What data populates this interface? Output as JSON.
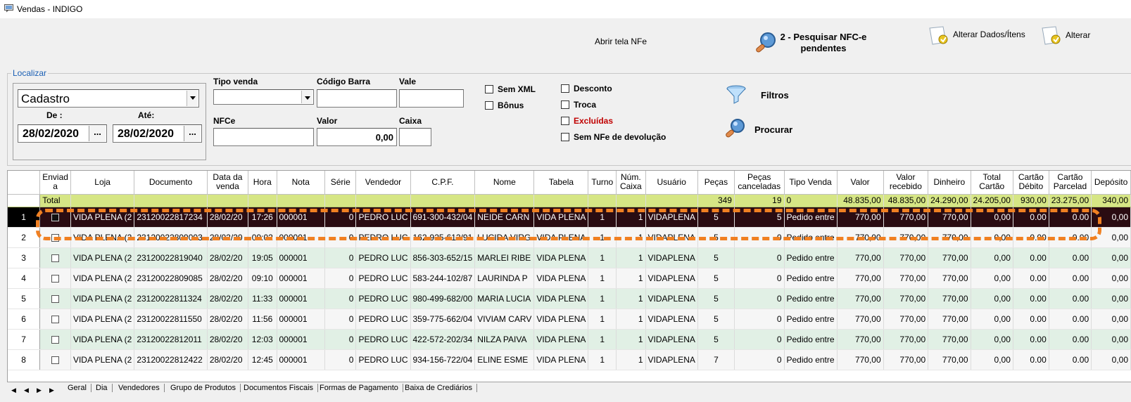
{
  "window": {
    "title": "Vendas - INDIGO"
  },
  "toolbar": {
    "open_nfe": "Abrir tela NFe",
    "pesquisar_line1": "2 - Pesquisar NFC-e",
    "pesquisar_line2": "pendentes",
    "alterar_dados": "Alterar Dados/Ítens",
    "alterar": "Alterar"
  },
  "search": {
    "group_title": "Localizar",
    "cadastro_value": "Cadastro",
    "de_label": "De :",
    "ate_label": "Até:",
    "de_value": "28/02/2020",
    "ate_value": "28/02/2020",
    "date_button": "...",
    "tipo_venda_label": "Tipo venda",
    "tipo_venda_value": "",
    "codigo_barra_label": "Código Barra",
    "codigo_barra_value": "",
    "vale_label": "Vale",
    "vale_value": "",
    "nfce_label": "NFCe",
    "nfce_value": "",
    "valor_label": "Valor",
    "valor_value": "0,00",
    "caixa_label": "Caixa",
    "caixa_value": "",
    "checkboxes": {
      "sem_xml": "Sem XML",
      "bonus": "Bônus",
      "desconto": "Desconto",
      "troca": "Troca",
      "excluidas": "Excluídas",
      "sem_nfe_devolucao": "Sem NFe de devolução"
    },
    "filtros": "Filtros",
    "procurar": "Procurar"
  },
  "colors": {
    "excluidas": "#c00000",
    "total_row": "#d6e685",
    "selected_row": "#2a0c12",
    "highlight": "#f08022",
    "even_row": "#e1f0e5"
  },
  "grid": {
    "headers": [
      "Enviad a",
      "Loja",
      "Documento",
      "Data da venda",
      "Hora",
      "Nota",
      "Série",
      "Vendedor",
      "C.P.F.",
      "Nome",
      "Tabela",
      "Turno",
      "Núm. Caixa",
      "Usuário",
      "Peças",
      "Peças canceladas",
      "Tipo Venda",
      "Valor",
      "Valor recebido",
      "Dinheiro",
      "Total Cartão",
      "Cartão Débito",
      "Cartão Parcelad",
      "Depósito"
    ],
    "total": {
      "label": "Total",
      "pecas": "349",
      "pecas_canceladas": "19",
      "tipo_venda": "0",
      "valor": "48.835,00",
      "valor_recebido": "48.835,00",
      "dinheiro": "24.290,00",
      "total_cartao": "24.205,00",
      "cartao_debito": "930,00",
      "cartao_parcelado": "23.275,00",
      "deposito": "340,00"
    },
    "rows": [
      {
        "n": "1",
        "loja": "VIDA PLENA (2",
        "doc": "23120022817234",
        "data": "28/02/20",
        "hora": "17:26",
        "nota": "000001",
        "serie": "0",
        "vendedor": "PEDRO LUC",
        "cpf": "691-300-432/04",
        "nome": "NEIDE CARN",
        "tabela": "VIDA PLENA",
        "turno": "1",
        "caixa": "1",
        "usuario": "VIDAPLENA",
        "pecas": "5",
        "canc": "5",
        "tipo": "Pedido entre",
        "valor": "770,00",
        "recebido": "770,00",
        "dinheiro": "770,00",
        "cartao": "0,00",
        "debito": "0.00",
        "parcelado": "0.00",
        "deposito": "0,00"
      },
      {
        "n": "2",
        "loja": "VIDA PLENA (2",
        "doc": "23120022809003",
        "data": "28/02/20",
        "hora": "09:02",
        "nota": "000001",
        "serie": "0",
        "vendedor": "PEDRO LUC",
        "cpf": "162-925-612/91",
        "nome": "LUCIDA VIRG",
        "tabela": "VIDA PLENA",
        "turno": "1",
        "caixa": "1",
        "usuario": "VIDAPLENA",
        "pecas": "5",
        "canc": "0",
        "tipo": "Pedido entre",
        "valor": "770,00",
        "recebido": "770,00",
        "dinheiro": "770,00",
        "cartao": "0,00",
        "debito": "0.00",
        "parcelado": "0.00",
        "deposito": "0,00"
      },
      {
        "n": "3",
        "loja": "VIDA PLENA (2",
        "doc": "23120022819040",
        "data": "28/02/20",
        "hora": "19:05",
        "nota": "000001",
        "serie": "0",
        "vendedor": "PEDRO LUC",
        "cpf": "856-303-652/15",
        "nome": "MARLEI RIBE",
        "tabela": "VIDA PLENA",
        "turno": "1",
        "caixa": "1",
        "usuario": "VIDAPLENA",
        "pecas": "5",
        "canc": "0",
        "tipo": "Pedido entre",
        "valor": "770,00",
        "recebido": "770,00",
        "dinheiro": "770,00",
        "cartao": "0,00",
        "debito": "0.00",
        "parcelado": "0.00",
        "deposito": "0,00"
      },
      {
        "n": "4",
        "loja": "VIDA PLENA (2",
        "doc": "23120022809085",
        "data": "28/02/20",
        "hora": "09:10",
        "nota": "000001",
        "serie": "0",
        "vendedor": "PEDRO LUC",
        "cpf": "583-244-102/87",
        "nome": "LAURINDA P",
        "tabela": "VIDA PLENA",
        "turno": "1",
        "caixa": "1",
        "usuario": "VIDAPLENA",
        "pecas": "5",
        "canc": "0",
        "tipo": "Pedido entre",
        "valor": "770,00",
        "recebido": "770,00",
        "dinheiro": "770,00",
        "cartao": "0,00",
        "debito": "0.00",
        "parcelado": "0.00",
        "deposito": "0,00"
      },
      {
        "n": "5",
        "loja": "VIDA PLENA (2",
        "doc": "23120022811324",
        "data": "28/02/20",
        "hora": "11:33",
        "nota": "000001",
        "serie": "0",
        "vendedor": "PEDRO LUC",
        "cpf": "980-499-682/00",
        "nome": "MARIA LUCIA",
        "tabela": "VIDA PLENA",
        "turno": "1",
        "caixa": "1",
        "usuario": "VIDAPLENA",
        "pecas": "5",
        "canc": "0",
        "tipo": "Pedido entre",
        "valor": "770,00",
        "recebido": "770,00",
        "dinheiro": "770,00",
        "cartao": "0,00",
        "debito": "0.00",
        "parcelado": "0.00",
        "deposito": "0,00"
      },
      {
        "n": "6",
        "loja": "VIDA PLENA (2",
        "doc": "23120022811550",
        "data": "28/02/20",
        "hora": "11:56",
        "nota": "000001",
        "serie": "0",
        "vendedor": "PEDRO LUC",
        "cpf": "359-775-662/04",
        "nome": "VIVIAM CARV",
        "tabela": "VIDA PLENA",
        "turno": "1",
        "caixa": "1",
        "usuario": "VIDAPLENA",
        "pecas": "5",
        "canc": "0",
        "tipo": "Pedido entre",
        "valor": "770,00",
        "recebido": "770,00",
        "dinheiro": "770,00",
        "cartao": "0,00",
        "debito": "0.00",
        "parcelado": "0.00",
        "deposito": "0,00"
      },
      {
        "n": "7",
        "loja": "VIDA PLENA (2",
        "doc": "23120022812011",
        "data": "28/02/20",
        "hora": "12:03",
        "nota": "000001",
        "serie": "0",
        "vendedor": "PEDRO LUC",
        "cpf": "422-572-202/34",
        "nome": "NILZA PAIVA",
        "tabela": "VIDA PLENA",
        "turno": "1",
        "caixa": "1",
        "usuario": "VIDAPLENA",
        "pecas": "5",
        "canc": "0",
        "tipo": "Pedido entre",
        "valor": "770,00",
        "recebido": "770,00",
        "dinheiro": "770,00",
        "cartao": "0,00",
        "debito": "0.00",
        "parcelado": "0.00",
        "deposito": "0,00"
      },
      {
        "n": "8",
        "loja": "VIDA PLENA (2",
        "doc": "23120022812422",
        "data": "28/02/20",
        "hora": "12:45",
        "nota": "000001",
        "serie": "0",
        "vendedor": "PEDRO LUC",
        "cpf": "934-156-722/04",
        "nome": "ELINE ESME",
        "tabela": "VIDA PLENA",
        "turno": "1",
        "caixa": "1",
        "usuario": "VIDAPLENA",
        "pecas": "7",
        "canc": "0",
        "tipo": "Pedido entre",
        "valor": "770,00",
        "recebido": "770,00",
        "dinheiro": "770,00",
        "cartao": "0,00",
        "debito": "0.00",
        "parcelado": "0.00",
        "deposito": "0,00"
      }
    ]
  },
  "tabs": [
    "Geral",
    "Dia",
    "Vendedores",
    "Grupo de Produtos",
    "Documentos Fiscais",
    "Formas de Pagamento",
    "Baixa de Crediários"
  ]
}
